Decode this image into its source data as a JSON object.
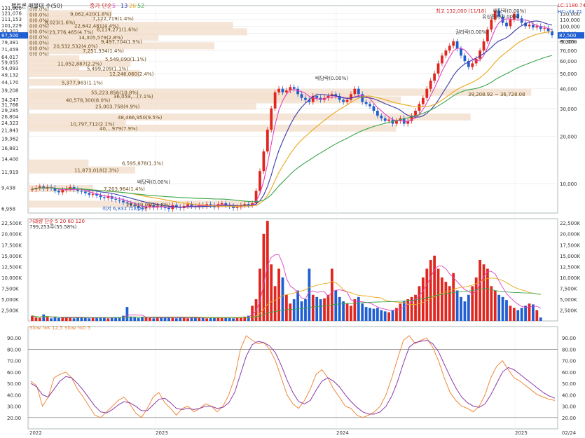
{
  "header": {
    "title": "펩트론 매물대 수(50)",
    "ma_legend_prefix": "종가 단순",
    "ma_periods": [
      "5",
      "13",
      "26",
      "52"
    ],
    "lc": "LC:1180.74",
    "hc": "HC:-33.71",
    "current_price": "87,500",
    "current_pct": "-5.30%"
  },
  "colors": {
    "up": "#e0261e",
    "down": "#1f5fd1",
    "ma5": "#e040c0",
    "ma13": "#3a3aa8",
    "ma26": "#e8a81a",
    "ma52": "#3aa54a",
    "volume_band": "#f3e1cf",
    "slow_k": "#f0883a",
    "slow_d": "#8a3aa8"
  },
  "chart_data": [
    {
      "type": "candlestick",
      "title": "펩트론 매물대 수(50)",
      "scale": "log",
      "y_ticks": [
        "131,000",
        "121,076",
        "111,153",
        "101,229",
        "93,303",
        "79,381",
        "71,459",
        "64,017",
        "59,055",
        "54,093",
        "49,132",
        "44,170",
        "39,208",
        "34,247",
        "31,766",
        "29,285",
        "26,804",
        "24,323",
        "21,843",
        "19,362",
        "16,881",
        "14,400",
        "11,919",
        "9,438",
        "6,958"
      ],
      "y_ticks_right": [
        "120,000",
        "110,000",
        "100,000",
        "90,000",
        "80,000",
        "70,000",
        "60,000",
        "50,000",
        "40,000",
        "30,000",
        "20,000",
        "10,000"
      ],
      "x_ticks": [
        "2022",
        "2023",
        "2024",
        "2025",
        "02/24"
      ],
      "annotations": {
        "high": "최고 132,000 (11/18)",
        "low": "최저 6,832 (12/26)",
        "ex_dividend_1": "배당락(0.00%)",
        "ex_dividend_2": "배당락(0.00%)",
        "ex_dividend_3": "배당락(0.00%)",
        "rights_1": "권리락(0.00%)",
        "rights_2": "유상증자(0.00%)",
        "range": "39,208.92 ~ 36,728.08"
      },
      "volume_profile": [
        {
          "label": "9,062,420(1.8%)"
        },
        {
          "label": "7,122,719(1.4%)"
        },
        {
          "label": "8,023(1.6%)"
        },
        {
          "label": "22,642,481(4.4%)"
        },
        {
          "label": "8,114,271(1.6%)"
        },
        {
          "label": "23,776,465(4.7%)"
        },
        {
          "label": "14,305,579(2.8%)"
        },
        {
          "label": "9,497,704(1.9%)"
        },
        {
          "label": "20,532,532(4.0%)"
        },
        {
          "label": "7,251,334(1.4%)"
        },
        {
          "label": "5,549,090(1.1%)"
        },
        {
          "label": "11,052,887(2.2%)"
        },
        {
          "label": "5,499,209(1.1%)"
        },
        {
          "label": "12,246,060(2.4%)"
        },
        {
          "label": "5,377,983(1.1%)"
        },
        {
          "label": "55,223,856(10.8%)"
        },
        {
          "label": "36,059,...(7.1%)"
        },
        {
          "label": "40,578,300(8.0%)"
        },
        {
          "label": "25,003,758(4.9%)"
        },
        {
          "label": "48,466,950(9.5%)"
        },
        {
          "label": "10,797,712(2.1%)"
        },
        {
          "label": "40,...979(7.9%)"
        },
        {
          "label": "6,595,878(1.3%)"
        },
        {
          "label": "11,873,018(2.3%)"
        },
        {
          "label": "7,203,964(1.4%)"
        },
        {
          "label": "24,629,060(4.8%)"
        }
      ],
      "zero_labels": [
        "0(0.0%)",
        "0(0.0%)",
        "0(0.0%)",
        "0(0.0%)",
        "0(0.0%)",
        "0(0.0%)",
        "0(0.0%)",
        "0(0.0%)",
        "0(0.0%)"
      ],
      "close_series": [
        9200,
        9400,
        9600,
        9300,
        9500,
        9400,
        9000,
        8800,
        9100,
        9300,
        9500,
        9200,
        9000,
        8900,
        8700,
        8500,
        8600,
        8400,
        8200,
        8100,
        8300,
        8000,
        7900,
        7800,
        7600,
        7500,
        7300,
        7200,
        7000,
        6950,
        7100,
        7300,
        7050,
        7200,
        7100,
        7000,
        6900,
        7300,
        7100,
        7000,
        7200,
        7400,
        7200,
        7100,
        7300,
        7200,
        7400,
        7300,
        7100,
        7400,
        7500,
        7300,
        7200,
        7000,
        7100,
        7300,
        7400,
        7300,
        7500,
        9000,
        12000,
        16000,
        22000,
        30000,
        38000,
        40000,
        38000,
        39000,
        41000,
        40000,
        37000,
        35000,
        34000,
        33000,
        36000,
        35000,
        34000,
        35000,
        36000,
        37000,
        36000,
        34000,
        33000,
        34000,
        37000,
        40000,
        37000,
        33000,
        32000,
        31000,
        29000,
        27000,
        26000,
        25000,
        25500,
        24000,
        25000,
        26000,
        24000,
        25000,
        27000,
        29000,
        32000,
        35000,
        40000,
        45000,
        50000,
        58000,
        65000,
        70000,
        75000,
        80000,
        72000,
        65000,
        60000,
        55000,
        58000,
        62000,
        70000,
        80000,
        95000,
        110000,
        125000,
        115000,
        105000,
        100000,
        110000,
        120000,
        112000,
        105000,
        100000,
        102000,
        98000,
        100000,
        96000,
        97000,
        93000,
        87500
      ],
      "volume_series": [
        1200,
        800,
        700,
        1500,
        900,
        600,
        800,
        700,
        900,
        800,
        700,
        600,
        800,
        900,
        700,
        600,
        800,
        700,
        900,
        800,
        600,
        700,
        800,
        900,
        1200,
        3200,
        1000,
        800,
        700,
        900,
        800,
        700,
        600,
        800,
        900,
        700,
        800,
        700,
        600,
        800,
        700,
        600,
        800,
        900,
        700,
        800,
        600,
        700,
        800,
        900,
        700,
        800,
        700,
        600,
        800,
        900,
        1000,
        1200,
        3500,
        5000,
        12000,
        20000,
        23000,
        13000,
        8000,
        12000,
        10000,
        6000,
        4000,
        5000,
        7000,
        4500,
        5000,
        12000,
        6000,
        5500,
        5000,
        5200,
        6000,
        12000,
        7000,
        5500,
        4500,
        4000,
        3500,
        5000,
        5500,
        4000,
        3200,
        3000,
        2800,
        3000,
        2500,
        2200,
        2000,
        2500,
        3000,
        4000,
        4500,
        5000,
        5500,
        6000,
        8000,
        10000,
        12000,
        14000,
        15000,
        12000,
        10000,
        9000,
        8000,
        11000,
        7000,
        5500,
        4500,
        6000,
        8000,
        10000,
        14000,
        13000,
        12000,
        8000,
        7000,
        6000,
        5500,
        4800,
        3500,
        3000,
        2500,
        3000,
        3500,
        4000,
        3800,
        2500,
        800
      ],
      "volume_legend": "거래량 단순 5 20 60 120",
      "volume_note": "799,253주(55.58%)",
      "volume_y_ticks": [
        "22,500K",
        "20,000K",
        "17,500K",
        "15,000K",
        "12,500K",
        "10,000K",
        "7,500K",
        "5,000K",
        "2,500K"
      ],
      "stoch_legend": "Slow %K 12,5  Slow %D 5",
      "stoch_y_ticks": [
        "90.00",
        "80.00",
        "70.00",
        "60.00",
        "50.00",
        "40.00",
        "30.00",
        "20.00"
      ],
      "stoch_k": [
        52,
        48,
        30,
        38,
        55,
        58,
        60,
        55,
        45,
        38,
        30,
        22,
        20,
        25,
        30,
        35,
        38,
        32,
        24,
        20,
        28,
        38,
        42,
        33,
        28,
        22,
        28,
        30,
        25,
        28,
        32,
        30,
        25,
        30,
        40,
        55,
        80,
        92,
        88,
        85,
        86,
        80,
        70,
        55,
        40,
        32,
        28,
        35,
        45,
        58,
        62,
        55,
        45,
        38,
        30,
        28,
        22,
        20,
        22,
        25,
        30,
        40,
        55,
        72,
        88,
        92,
        85,
        88,
        90,
        82,
        70,
        55,
        42,
        35,
        30,
        28,
        25,
        30,
        40,
        55,
        65,
        70,
        62,
        55,
        52,
        48,
        44,
        40,
        38,
        36,
        35
      ],
      "stoch_d": [
        50,
        47,
        40,
        38,
        45,
        52,
        56,
        55,
        50,
        44,
        37,
        30,
        25,
        24,
        27,
        31,
        34,
        33,
        30,
        26,
        26,
        31,
        36,
        37,
        33,
        28,
        27,
        28,
        27,
        28,
        30,
        30,
        28,
        29,
        33,
        42,
        58,
        74,
        84,
        87,
        86,
        83,
        77,
        66,
        53,
        42,
        34,
        32,
        35,
        44,
        52,
        55,
        52,
        47,
        40,
        34,
        29,
        25,
        23,
        23,
        25,
        30,
        39,
        52,
        68,
        82,
        86,
        87,
        88,
        85,
        78,
        67,
        56,
        46,
        38,
        33,
        30,
        29,
        32,
        40,
        50,
        60,
        64,
        62,
        58,
        54,
        50,
        46,
        42,
        39,
        37
      ]
    }
  ]
}
